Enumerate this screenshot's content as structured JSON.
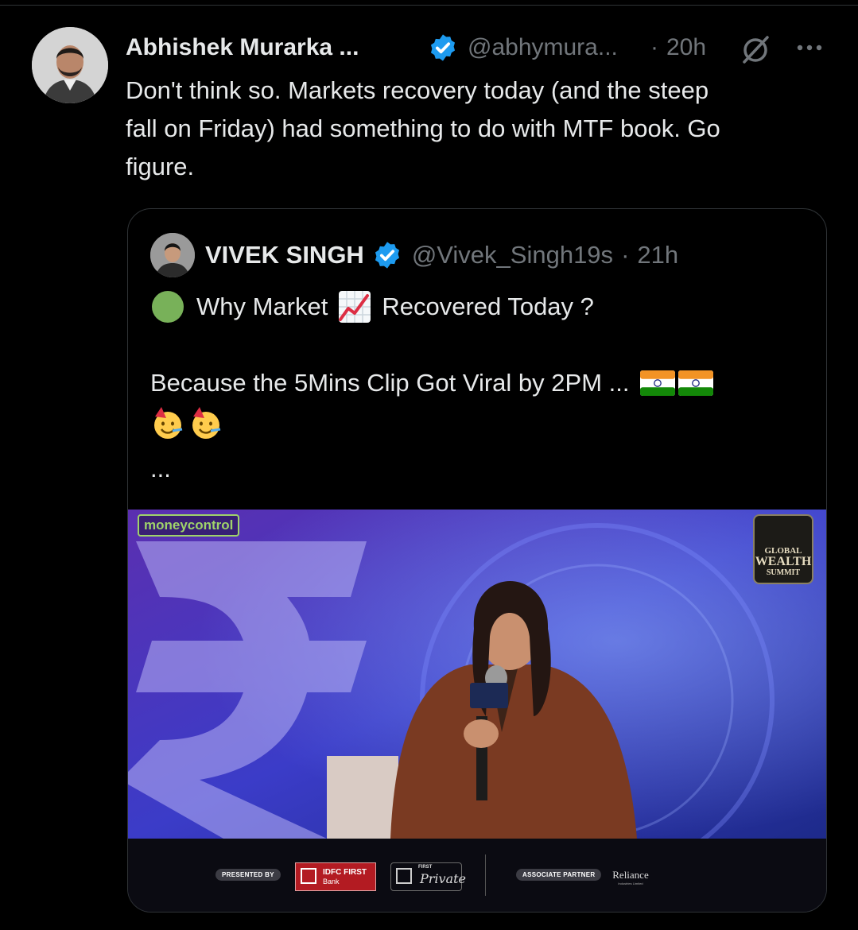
{
  "tweet": {
    "author_name": "Abhishek Murarka ...",
    "handle": "@abhymura...",
    "separator": "·",
    "time": "20h",
    "lines": [
      "Don't think so. Markets recovery today (and the steep",
      "fall on Friday) had something to do with MTF book. Go",
      "figure."
    ]
  },
  "quote": {
    "author_name": "VIVEK SINGH",
    "handle": "@Vivek_Singh19s",
    "separator": "·",
    "time": "21h",
    "line1_a": "Why Market",
    "line1_b": "Recovered Today ?",
    "line2": "Because the 5Mins Clip Got Viral by 2PM ...",
    "ellipsis": "..."
  },
  "media": {
    "logo_text": "moneycontrol",
    "event_logo": {
      "line1": "GLOBAL",
      "line2": "WEALTH",
      "line3": "SUMMIT"
    },
    "sponsors": {
      "presented_by": "PRESENTED BY",
      "idfc_line1": "IDFC FIRST",
      "idfc_line2": "Bank",
      "first_private_top": "FIRST",
      "first_private_script": "Private",
      "associate_partner": "ASSOCIATE PARTNER",
      "reliance": "Reliance",
      "reliance_sub": "Industries Limited"
    }
  },
  "colors": {
    "background": "#000000",
    "text_primary": "#e7e9ea",
    "text_secondary": "#71767b",
    "verified_blue": "#1d9bf0",
    "border": "#2f3336"
  },
  "icons": [
    "verified-badge-icon",
    "grok-icon",
    "more-options-icon",
    "green-circle-emoji",
    "chart-increasing-emoji",
    "india-flag-emoji",
    "partying-face-emoji"
  ]
}
